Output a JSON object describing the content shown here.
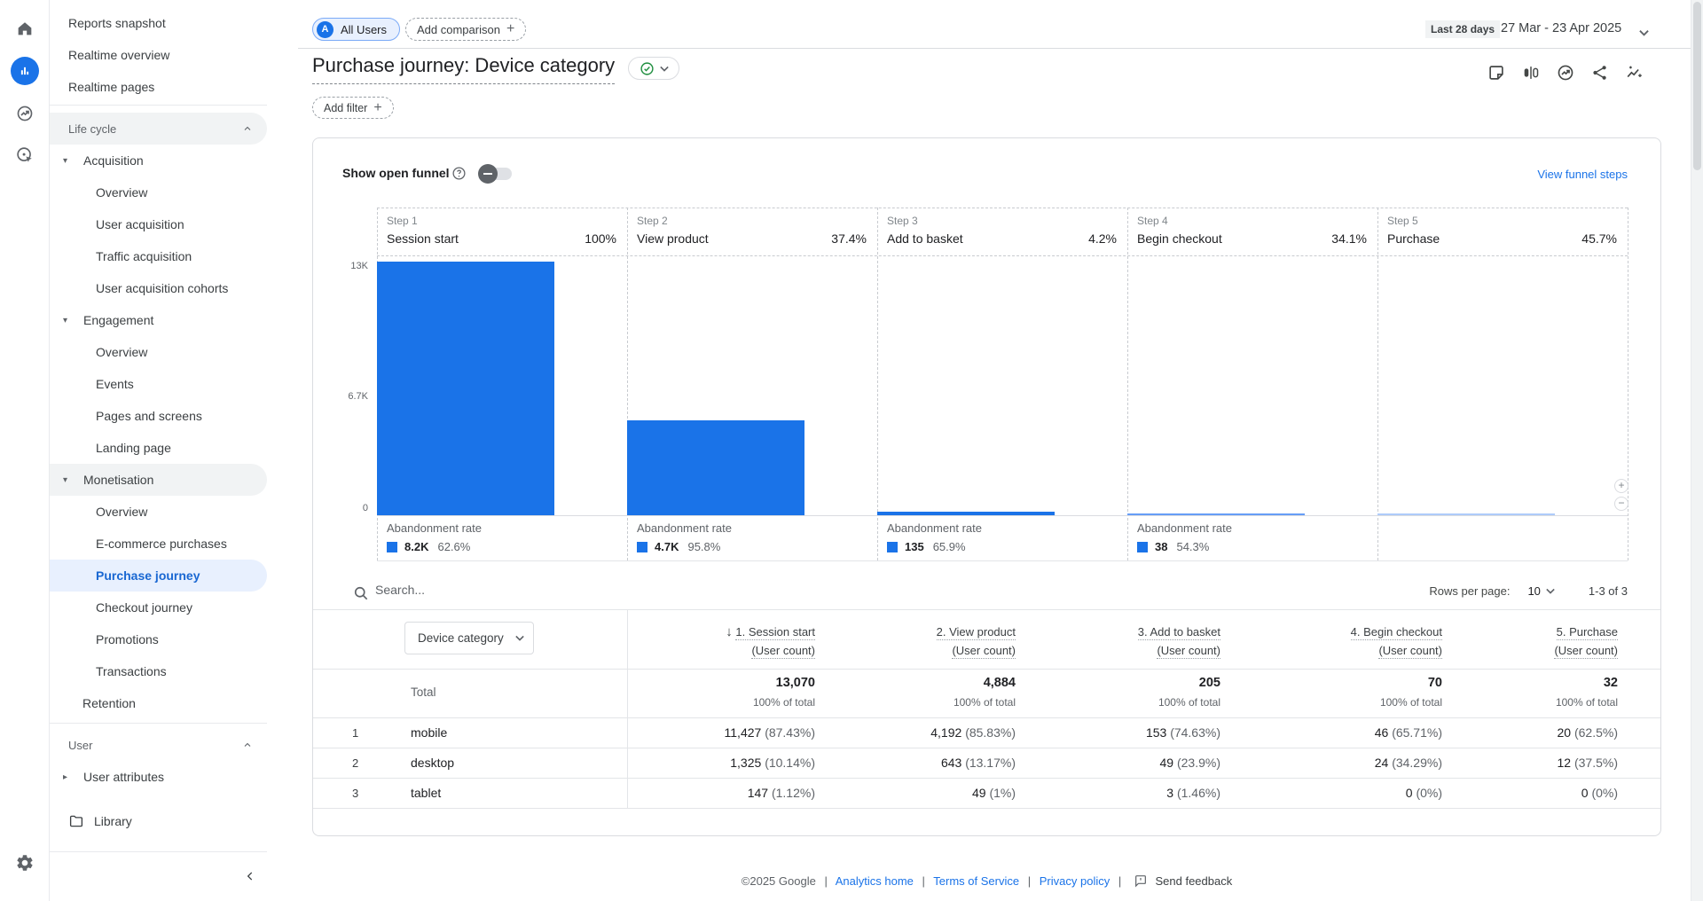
{
  "header": {
    "avatar_letter": "A",
    "all_users_label": "All Users",
    "add_comparison_label": "Add comparison",
    "plus_glyph": "+",
    "date_preset": "Last 28 days",
    "date_range": "27 Mar - 23 Apr 2025",
    "title": "Purchase journey: Device category",
    "add_filter_label": "Add filter"
  },
  "sidebar": {
    "top_items": [
      "Reports snapshot",
      "Realtime overview",
      "Realtime pages"
    ],
    "lifecycle_label": "Life cycle",
    "acquisition_label": "Acquisition",
    "acquisition_items": [
      "Overview",
      "User acquisition",
      "Traffic acquisition",
      "User acquisition cohorts"
    ],
    "engagement_label": "Engagement",
    "engagement_items": [
      "Overview",
      "Events",
      "Pages and screens",
      "Landing page"
    ],
    "monetisation_label": "Monetisation",
    "monetisation_items": [
      "Overview",
      "E-commerce purchases",
      "Purchase journey",
      "Checkout journey",
      "Promotions",
      "Transactions"
    ],
    "retention_label": "Retention",
    "user_label": "User",
    "user_attributes_label": "User attributes",
    "library_label": "Library",
    "expand_caret": "▾",
    "collapsed_caret": "▸"
  },
  "funnel": {
    "show_open_funnel_label": "Show open funnel",
    "view_funnel_steps_label": "View funnel steps",
    "abandonment_label": "Abandonment rate",
    "y_ticks": [
      "13K",
      "6.7K",
      "0"
    ],
    "steps": [
      {
        "step": "Step 1",
        "name": "Session start",
        "pct": "100%",
        "abandon_value": "8.2K",
        "abandon_rate": "62.6%"
      },
      {
        "step": "Step 2",
        "name": "View product",
        "pct": "37.4%",
        "abandon_value": "4.7K",
        "abandon_rate": "95.8%"
      },
      {
        "step": "Step 3",
        "name": "Add to basket",
        "pct": "4.2%",
        "abandon_value": "135",
        "abandon_rate": "65.9%"
      },
      {
        "step": "Step 4",
        "name": "Begin checkout",
        "pct": "34.1%",
        "abandon_value": "38",
        "abandon_rate": "54.3%"
      },
      {
        "step": "Step 5",
        "name": "Purchase",
        "pct": "45.7%"
      }
    ]
  },
  "chart_data": {
    "type": "bar",
    "title": "Purchase journey funnel by step",
    "categories": [
      "Session start",
      "View product",
      "Add to basket",
      "Begin checkout",
      "Purchase"
    ],
    "values": [
      13070,
      4884,
      205,
      70,
      32
    ],
    "completion_rates": [
      "100%",
      "37.4%",
      "4.2%",
      "34.1%",
      "45.7%"
    ],
    "abandonment_values": [
      "8.2K",
      "4.7K",
      "135",
      "38"
    ],
    "abandonment_rates": [
      "62.6%",
      "95.8%",
      "65.9%",
      "54.3%"
    ],
    "ylabel": "",
    "ylim": [
      0,
      13070
    ],
    "y_ticks": [
      "13K",
      "6.7K",
      "0"
    ],
    "bar_color": "#1a73e8"
  },
  "table": {
    "search_placeholder": "Search...",
    "rows_per_page_label": "Rows per page:",
    "rows_per_page_value": "10",
    "pagination": "1-3 of 3",
    "dimension_label": "Device category",
    "columns": [
      {
        "title": "1. Session start",
        "sub": "(User count)"
      },
      {
        "title": "2. View product",
        "sub": "(User count)"
      },
      {
        "title": "3. Add to basket",
        "sub": "(User count)"
      },
      {
        "title": "4. Begin checkout",
        "sub": "(User count)"
      },
      {
        "title": "5. Purchase",
        "sub": "(User count)"
      }
    ],
    "total_label": "Total",
    "total": [
      {
        "v": "13,070",
        "p": "100% of total"
      },
      {
        "v": "4,884",
        "p": "100% of total"
      },
      {
        "v": "205",
        "p": "100% of total"
      },
      {
        "v": "70",
        "p": "100% of total"
      },
      {
        "v": "32",
        "p": "100% of total"
      }
    ],
    "rows": [
      {
        "num": "1",
        "dim": "mobile",
        "cells": [
          {
            "v": "11,427",
            "p": "(87.43%)"
          },
          {
            "v": "4,192",
            "p": "(85.83%)"
          },
          {
            "v": "153",
            "p": "(74.63%)"
          },
          {
            "v": "46",
            "p": "(65.71%)"
          },
          {
            "v": "20",
            "p": "(62.5%)"
          }
        ]
      },
      {
        "num": "2",
        "dim": "desktop",
        "cells": [
          {
            "v": "1,325",
            "p": "(10.14%)"
          },
          {
            "v": "643",
            "p": "(13.17%)"
          },
          {
            "v": "49",
            "p": "(23.9%)"
          },
          {
            "v": "24",
            "p": "(34.29%)"
          },
          {
            "v": "12",
            "p": "(37.5%)"
          }
        ]
      },
      {
        "num": "3",
        "dim": "tablet",
        "cells": [
          {
            "v": "147",
            "p": "(1.12%)"
          },
          {
            "v": "49",
            "p": "(1%)"
          },
          {
            "v": "3",
            "p": "(1.46%)"
          },
          {
            "v": "0",
            "p": "(0%)"
          },
          {
            "v": "0",
            "p": "(0%)"
          }
        ]
      }
    ]
  },
  "footer": {
    "copyright": "©2025 Google",
    "divider": "|",
    "links": [
      "Analytics home",
      "Terms of Service",
      "Privacy policy"
    ],
    "feedback_label": "Send feedback"
  },
  "colors": {
    "accent_blue": "#1a73e8",
    "selected_text": "#1967d2",
    "selected_bg": "#e8f0fe",
    "bar_blue": "#1a73e8",
    "bar_light_blue": "#669df6",
    "bar_lighter_blue": "#aecbfa",
    "check_green": "#1e8e3e"
  }
}
